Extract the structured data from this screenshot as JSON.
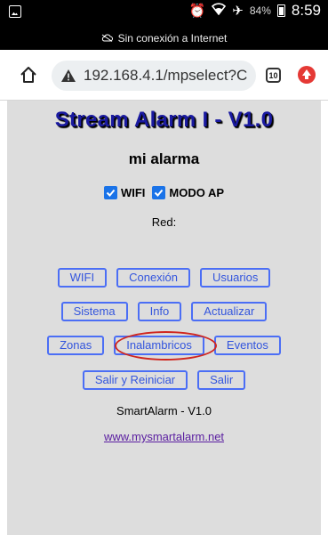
{
  "status_bar": {
    "battery_pct": "84%",
    "time": "8:59",
    "network_notice": "Sin conexión a Internet"
  },
  "browser": {
    "url": "192.168.4.1/mpselect?C",
    "tab_count": "10"
  },
  "page": {
    "title": "Stream Alarm I - V1.0",
    "alarm_name": "mi alarma",
    "checkboxes": [
      {
        "label": "WIFI",
        "checked": true
      },
      {
        "label": "MODO AP",
        "checked": true
      }
    ],
    "red_label": "Red:",
    "buttons": {
      "wifi": "WIFI",
      "conexion": "Conexión",
      "usuarios": "Usuarios",
      "sistema": "Sistema",
      "info": "Info",
      "actualizar": "Actualizar",
      "zonas": "Zonas",
      "inalambricos": "Inalambricos",
      "eventos": "Eventos",
      "salir_reiniciar": "Salir y Reiniciar",
      "salir": "Salir"
    },
    "footer_text": "SmartAlarm - V1.0",
    "footer_link": "www.mysmartalarm.net"
  },
  "colors": {
    "title": "#1a1aa0",
    "button_border": "#4b6ef5",
    "highlight_ellipse": "#d0261f",
    "page_bg": "#dddddd"
  }
}
